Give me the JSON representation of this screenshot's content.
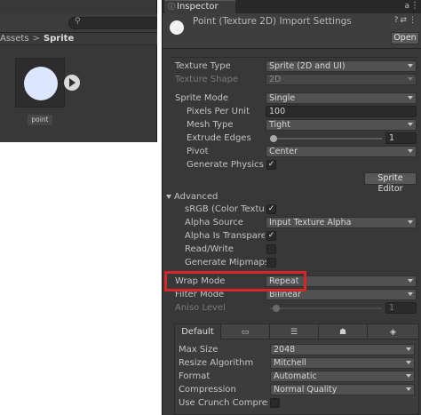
{
  "project": {
    "search_placeholder": "",
    "search_glyph": "⚲",
    "breadcrumb": [
      "Assets",
      "Sprite"
    ],
    "breadcrumb_sep": ">",
    "asset_name": "point",
    "asset_color": "#dde6ff"
  },
  "inspector": {
    "tab_label": "Inspector",
    "tab_icon": "ⓘ",
    "lock_glyph": "🔒",
    "menu_glyph": "⋮",
    "title": "Point (Texture 2D) Import Settings",
    "header_icons": [
      "?",
      "⇄",
      "⋮"
    ],
    "open_label": "Open",
    "fields": {
      "texture_type": {
        "label": "Texture Type",
        "value": "Sprite (2D and UI)"
      },
      "texture_shape": {
        "label": "Texture Shape",
        "value": "2D"
      },
      "sprite_mode": {
        "label": "Sprite Mode",
        "value": "Single"
      },
      "pixels_per_unit": {
        "label": "Pixels Per Unit",
        "value": "100"
      },
      "mesh_type": {
        "label": "Mesh Type",
        "value": "Tight"
      },
      "extrude_edges": {
        "label": "Extrude Edges",
        "value": "1"
      },
      "pivot": {
        "label": "Pivot",
        "value": "Center"
      },
      "generate_physics_shape": {
        "label": "Generate Physics Sh",
        "checked": true
      },
      "sprite_editor_label": "Sprite Editor",
      "advanced_label": "Advanced",
      "srgb": {
        "label": "sRGB (Color Texture",
        "checked": true
      },
      "alpha_source": {
        "label": "Alpha Source",
        "value": "Input Texture Alpha"
      },
      "alpha_is_transparency": {
        "label": "Alpha Is Transparenc",
        "checked": true
      },
      "read_write": {
        "label": "Read/Write",
        "checked": false
      },
      "generate_mipmaps": {
        "label": "Generate Mipmaps",
        "checked": false
      },
      "wrap_mode": {
        "label": "Wrap Mode",
        "value": "Repeat"
      },
      "filter_mode": {
        "label": "Filter Mode",
        "value": "Bilinear"
      },
      "aniso_level": {
        "label": "Aniso Level",
        "value": "1"
      }
    },
    "platform": {
      "default_tab": "Default",
      "tab_icons": [
        "monitor-icon",
        "server-icon",
        "android-icon",
        "webgl-icon"
      ],
      "tab_glyphs": [
        "▭",
        "☰",
        "☗",
        "◈"
      ],
      "max_size": {
        "label": "Max Size",
        "value": "2048"
      },
      "resize_algorithm": {
        "label": "Resize Algorithm",
        "value": "Mitchell"
      },
      "format": {
        "label": "Format",
        "value": "Automatic"
      },
      "compression": {
        "label": "Compression",
        "value": "Normal Quality"
      },
      "use_crunch": {
        "label": "Use Crunch Compressic",
        "checked": false
      }
    }
  },
  "colors": {
    "panel_bg": "#383838",
    "highlight": "#d6262a"
  }
}
